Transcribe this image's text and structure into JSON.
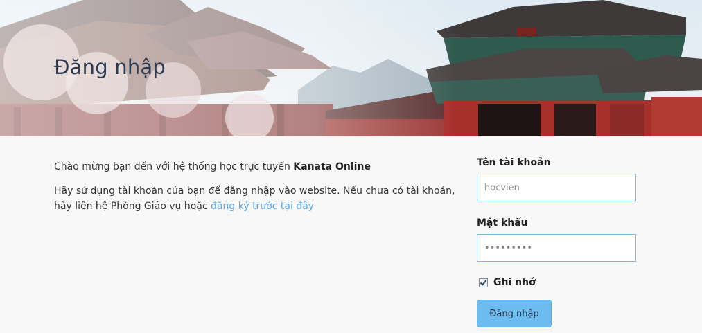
{
  "banner": {
    "title": "Đăng nhập"
  },
  "intro": {
    "welcome_prefix": "Chào mừng bạn đến với hệ thống học trực tuyến ",
    "site_name": "Kanata Online",
    "instruction": "Hãy sử dụng tài khoản của bạn để đăng nhập vào website. Nếu chưa có tài khoản, hãy liên hệ Phòng Giáo vụ hoặc ",
    "register_link": "đăng ký trước tại đây"
  },
  "form": {
    "username_label": "Tên tài khoản",
    "username_value": "hocvien",
    "password_label": "Mật khẩu",
    "password_value": "hocvien12",
    "remember_label": "Ghi nhớ",
    "remember_checked": true,
    "submit_label": "Đăng nhập"
  },
  "colors": {
    "accent": "#6dbcf0",
    "link": "#5aa7e0",
    "input_border": "#7fbbe4",
    "title": "#2f3b52"
  }
}
